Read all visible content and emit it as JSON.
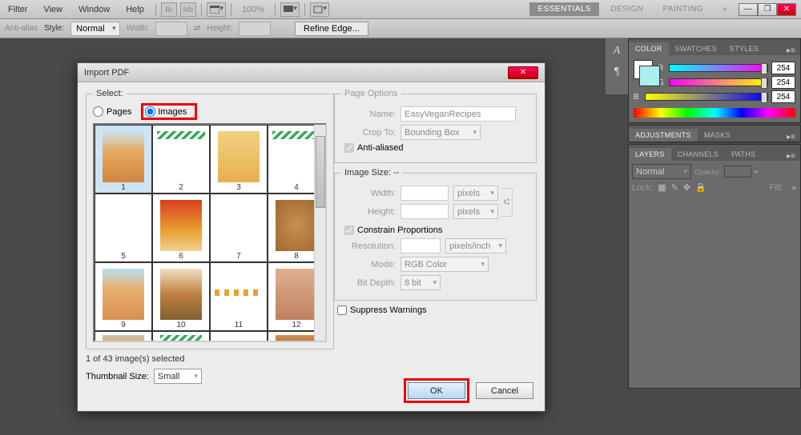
{
  "menubar": {
    "items": [
      "Filter",
      "View",
      "Window",
      "Help"
    ],
    "zoom": "100%"
  },
  "workspace_tabs": [
    "ESSENTIALS",
    "DESIGN",
    "PAINTING"
  ],
  "optbar": {
    "antialias": "Anti-alias",
    "style_label": "Style:",
    "style_value": "Normal",
    "width": "Width:",
    "height": "Height:",
    "refine": "Refine Edge..."
  },
  "dialog": {
    "title": "Import PDF",
    "select_legend": "Select:",
    "radio_pages": "Pages",
    "radio_images": "Images",
    "status": "1 of 43 image(s) selected",
    "thumb_label": "Thumbnail Size:",
    "thumb_value": "Small",
    "page_options": {
      "legend": "Page Options",
      "name": "Name:",
      "name_val": "EasyVeganRecipes",
      "crop": "Crop To:",
      "crop_val": "Bounding Box",
      "aa": "Anti-aliased"
    },
    "image_size": {
      "legend": "Image Size: --",
      "w": "Width:",
      "h": "Height:",
      "u": "pixels",
      "cp": "Constrain Proportions",
      "res": "Resolution:",
      "res_u": "pixels/inch",
      "mode": "Mode:",
      "mode_v": "RGB Color",
      "bd": "Bit Depth:",
      "bd_v": "8 bit"
    },
    "suppress": "Suppress Warnings",
    "ok": "OK",
    "cancel": "Cancel",
    "thumbs": [
      "1",
      "2",
      "3",
      "4",
      "5",
      "6",
      "7",
      "8",
      "9",
      "10",
      "11",
      "12"
    ]
  },
  "panels": {
    "color": {
      "tabs": [
        "COLOR",
        "SWATCHES",
        "STYLES"
      ],
      "r": "R",
      "g": "G",
      "b": "B",
      "val": "254"
    },
    "adjustments": {
      "tabs": [
        "ADJUSTMENTS",
        "MASKS"
      ]
    },
    "layers": {
      "tabs": [
        "LAYERS",
        "CHANNELS",
        "PATHS"
      ],
      "blend": "Normal",
      "opacity": "Opacity:",
      "lock": "Lock:",
      "fill": "Fill:"
    }
  }
}
